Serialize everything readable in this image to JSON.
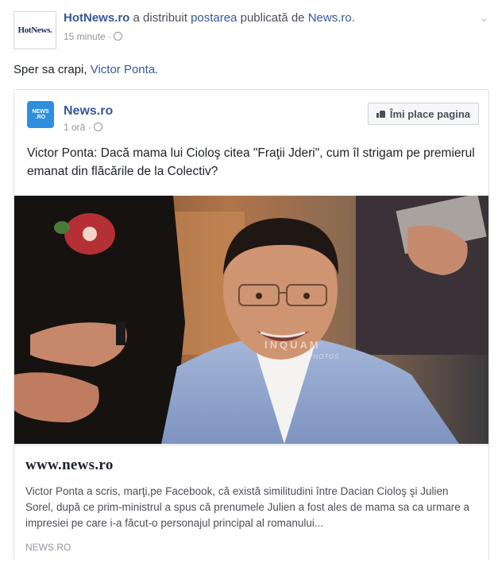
{
  "share": {
    "sharer_avatar_text": "HotNews.",
    "sharer_name": "HotNews.ro",
    "action_text": "a distribuit",
    "post_link": "postarea",
    "action_text_2": "publicată de",
    "source_link": "News.ro.",
    "time": "15 minute"
  },
  "status": {
    "text": "Sper sa crapi,",
    "mention": "Victor Ponta."
  },
  "shared_post": {
    "avatar_line1": "NEWS",
    "avatar_line2": ".RO",
    "page_name": "News.ro",
    "time": "1 oră",
    "like_button_label": "Îmi place pagina",
    "text": "Victor Ponta: Dacă mama lui Cioloş citea \"Fraţii Jderi\", cum îl strigam pe premierul emanat din flăcările de la Colectiv?",
    "photo_watermark": "INQUAM",
    "photo_watermark_sub": "PHOTOS",
    "link": {
      "title": "www.news.ro",
      "description": "Victor Ponta a scris, marţi,pe Facebook, că există similitudini între Dacian Cioloş şi Julien Sorel, după ce prim-ministrul a spus că prenumele Julien a fost ales de mama sa ca urmare a impresiei pe care i-a făcut-o personajul principal al romanului...",
      "domain": "NEWS.RO"
    }
  },
  "colors": {
    "link": "#365899",
    "meta": "#90949c",
    "news_avatar": "#2e8fde"
  }
}
